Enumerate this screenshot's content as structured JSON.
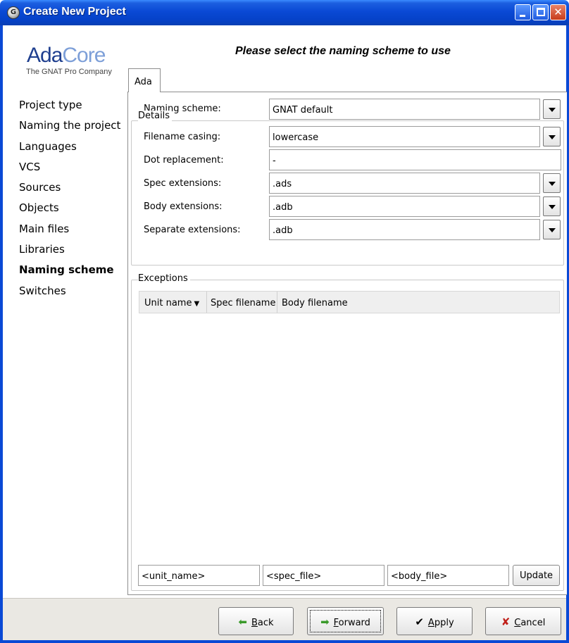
{
  "window": {
    "title": "Create New Project",
    "icon": "gps-icon",
    "controls": {
      "minimize": "minimize-icon",
      "maximize": "maximize-icon",
      "close": "close-icon"
    }
  },
  "logo": {
    "text_part1": "Ada",
    "text_part2": "Core",
    "tagline": "The GNAT Pro Company"
  },
  "steps": [
    {
      "label": "Project type",
      "active": false
    },
    {
      "label": "Naming the project",
      "active": false
    },
    {
      "label": "Languages",
      "active": false
    },
    {
      "label": "VCS",
      "active": false
    },
    {
      "label": "Sources",
      "active": false
    },
    {
      "label": "Objects",
      "active": false
    },
    {
      "label": "Main files",
      "active": false
    },
    {
      "label": "Libraries",
      "active": false
    },
    {
      "label": "Naming scheme",
      "active": true
    },
    {
      "label": "Switches",
      "active": false
    }
  ],
  "header": "Please select the naming scheme to use",
  "tabs": [
    {
      "label": "Ada",
      "selected": true
    }
  ],
  "naming_scheme": {
    "label": "Naming scheme:",
    "value": "GNAT default"
  },
  "details": {
    "title": "Details",
    "filename_casing": {
      "label": "Filename casing:",
      "value": "lowercase"
    },
    "dot_replacement": {
      "label": "Dot replacement:",
      "value": "-"
    },
    "spec_extensions": {
      "label": "Spec extensions:",
      "value": ".ads"
    },
    "body_extensions": {
      "label": "Body extensions:",
      "value": ".adb"
    },
    "separate_extensions": {
      "label": "Separate extensions:",
      "value": ".adb"
    }
  },
  "exceptions": {
    "title": "Exceptions",
    "columns": [
      "Unit name",
      "Spec filename",
      "Body filename"
    ],
    "sort_indicator": "▼",
    "rows": [],
    "inputs": {
      "unit_name": "<unit_name>",
      "spec_file": "<spec_file>",
      "body_file": "<body_file>"
    },
    "update_label": "Update"
  },
  "buttons": {
    "back": {
      "label_mnemonic": "B",
      "label_rest": "ack",
      "icon": "arrow-left-icon"
    },
    "forward": {
      "label_mnemonic": "F",
      "label_rest": "orward",
      "icon": "arrow-right-icon"
    },
    "apply": {
      "label_mnemonic": "A",
      "label_rest": "pply",
      "icon": "checkmark-icon"
    },
    "cancel": {
      "label_mnemonic": "C",
      "label_rest": "ancel",
      "icon": "x-icon"
    }
  },
  "colors": {
    "titlebar": "#0a49d5",
    "logo_dark": "#1f3f8f",
    "logo_light": "#7d9fd8",
    "arrow_green": "#3a9a2a",
    "cancel_red": "#c0201a"
  }
}
